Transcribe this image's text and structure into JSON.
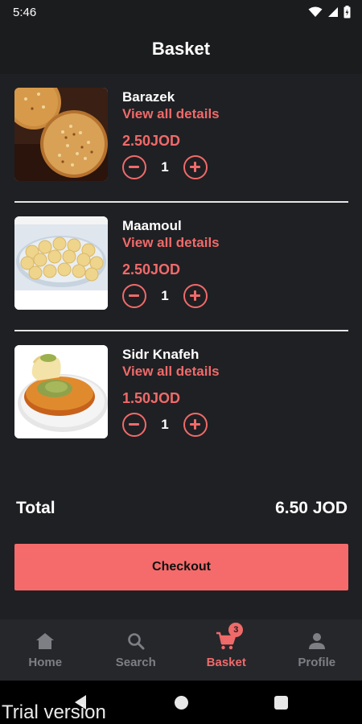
{
  "status_bar": {
    "time": "5:46",
    "icons": [
      "wifi-icon",
      "signal-icon",
      "battery-icon"
    ]
  },
  "header": {
    "title": "Basket"
  },
  "basket": {
    "items": [
      {
        "name": "Barazek",
        "details_link": "View all details",
        "price": "2.50JOD",
        "quantity": "1",
        "image": "barazek-cookies-image"
      },
      {
        "name": "Maamoul",
        "details_link": "View all details",
        "price": "2.50JOD",
        "quantity": "1",
        "image": "maamoul-pastries-image"
      },
      {
        "name": "Sidr Knafeh",
        "details_link": "View all details",
        "price": "1.50JOD",
        "quantity": "1",
        "image": "knafeh-dessert-image"
      }
    ]
  },
  "summary": {
    "total_label": "Total",
    "total_value": "6.50 JOD"
  },
  "checkout": {
    "label": "Checkout"
  },
  "bottom_nav": {
    "items": [
      {
        "label": "Home",
        "icon": "home-icon",
        "active": false
      },
      {
        "label": "Search",
        "icon": "search-icon",
        "active": false
      },
      {
        "label": "Basket",
        "icon": "cart-icon",
        "active": true,
        "badge": "3"
      },
      {
        "label": "Profile",
        "icon": "profile-icon",
        "active": false
      }
    ]
  },
  "colors": {
    "background": "#1f2023",
    "accent": "#f06a6a",
    "checkout_button": "#f56b6b",
    "nav_inactive": "#7e7f84"
  },
  "watermark": {
    "text": "Trial version"
  }
}
